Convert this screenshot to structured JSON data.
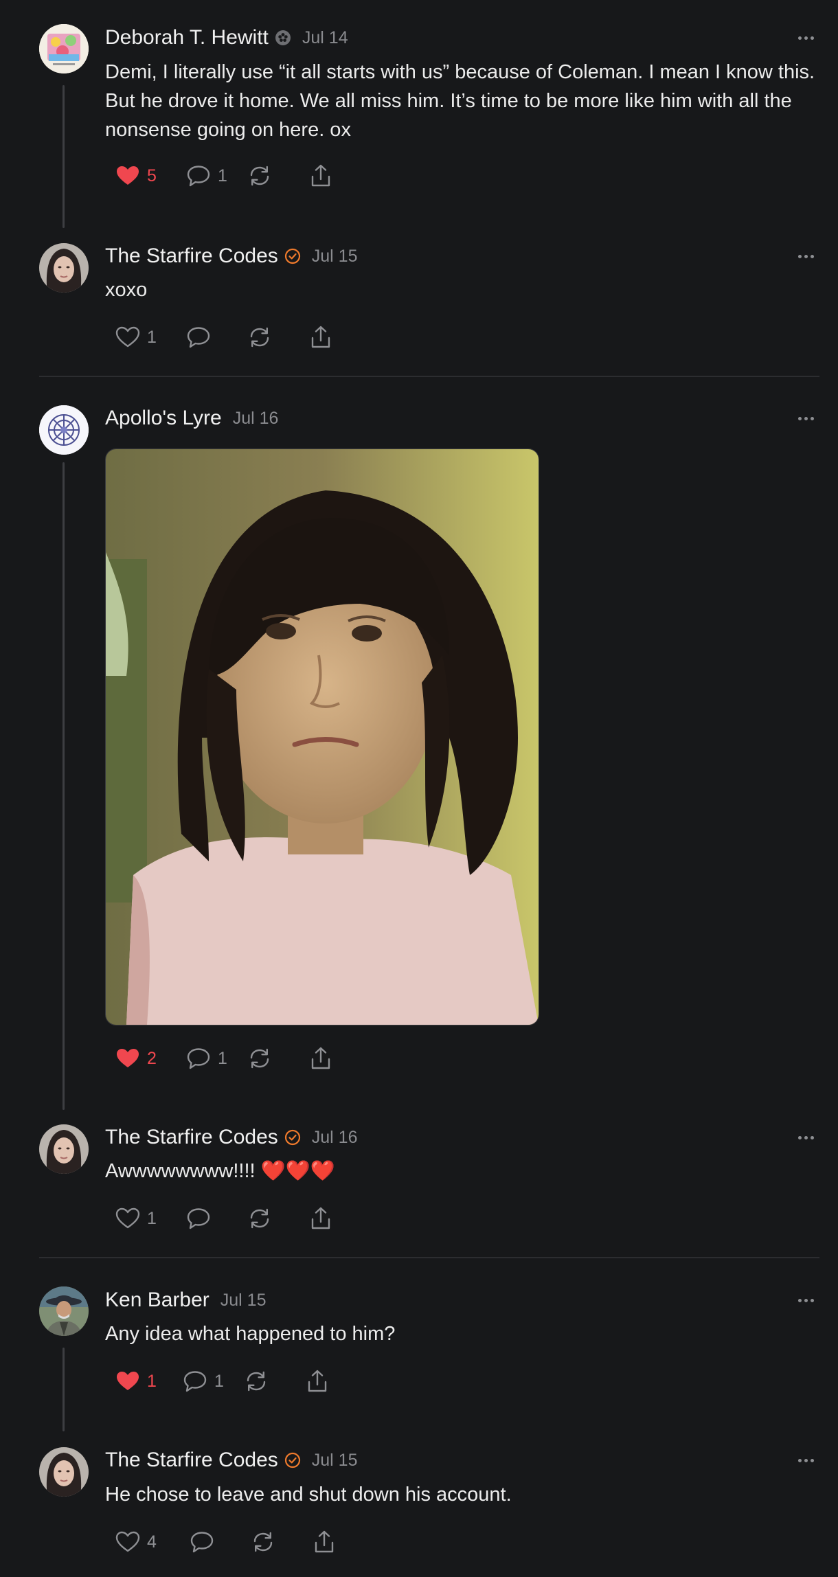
{
  "colors": {
    "background": "#17181a",
    "liked": "#f0474f",
    "verified_badge": "#ef7a2c",
    "muted": "#8f9094"
  },
  "posts": [
    {
      "author": "Deborah T. Hewitt",
      "badge": "gray-flower-badge-icon",
      "date": "Jul 14",
      "body": "Demi, I literally use “it all starts with us” because of Coleman. I mean I know this. But he drove it home. We all miss him. It’s time to be more like him with all the nonsense going on here. ox",
      "likes": "5",
      "liked": true,
      "replies": "1"
    },
    {
      "author": "The Starfire Codes",
      "badge": "verified-check-icon",
      "date": "Jul 15",
      "body": "xoxo",
      "likes": "1",
      "liked": false,
      "replies": ""
    },
    {
      "author": "Apollo's Lyre",
      "date": "Jul 16",
      "body": "",
      "media": "photo of a young girl with dark bob haircut and a pouting expression",
      "likes": "2",
      "liked": true,
      "replies": "1"
    },
    {
      "author": "The Starfire Codes",
      "badge": "verified-check-icon",
      "date": "Jul 16",
      "body": "Awwwwwwww!!!! ❤️❤️❤️",
      "likes": "1",
      "liked": false,
      "replies": ""
    },
    {
      "author": "Ken Barber",
      "date": "Jul 15",
      "body": "Any idea what happened to him?",
      "likes": "1",
      "liked": true,
      "replies": "1"
    },
    {
      "author": "The Starfire Codes",
      "badge": "verified-check-icon",
      "date": "Jul 15",
      "body": "He chose to leave and shut down his account.",
      "likes": "4",
      "liked": false,
      "replies": ""
    }
  ]
}
